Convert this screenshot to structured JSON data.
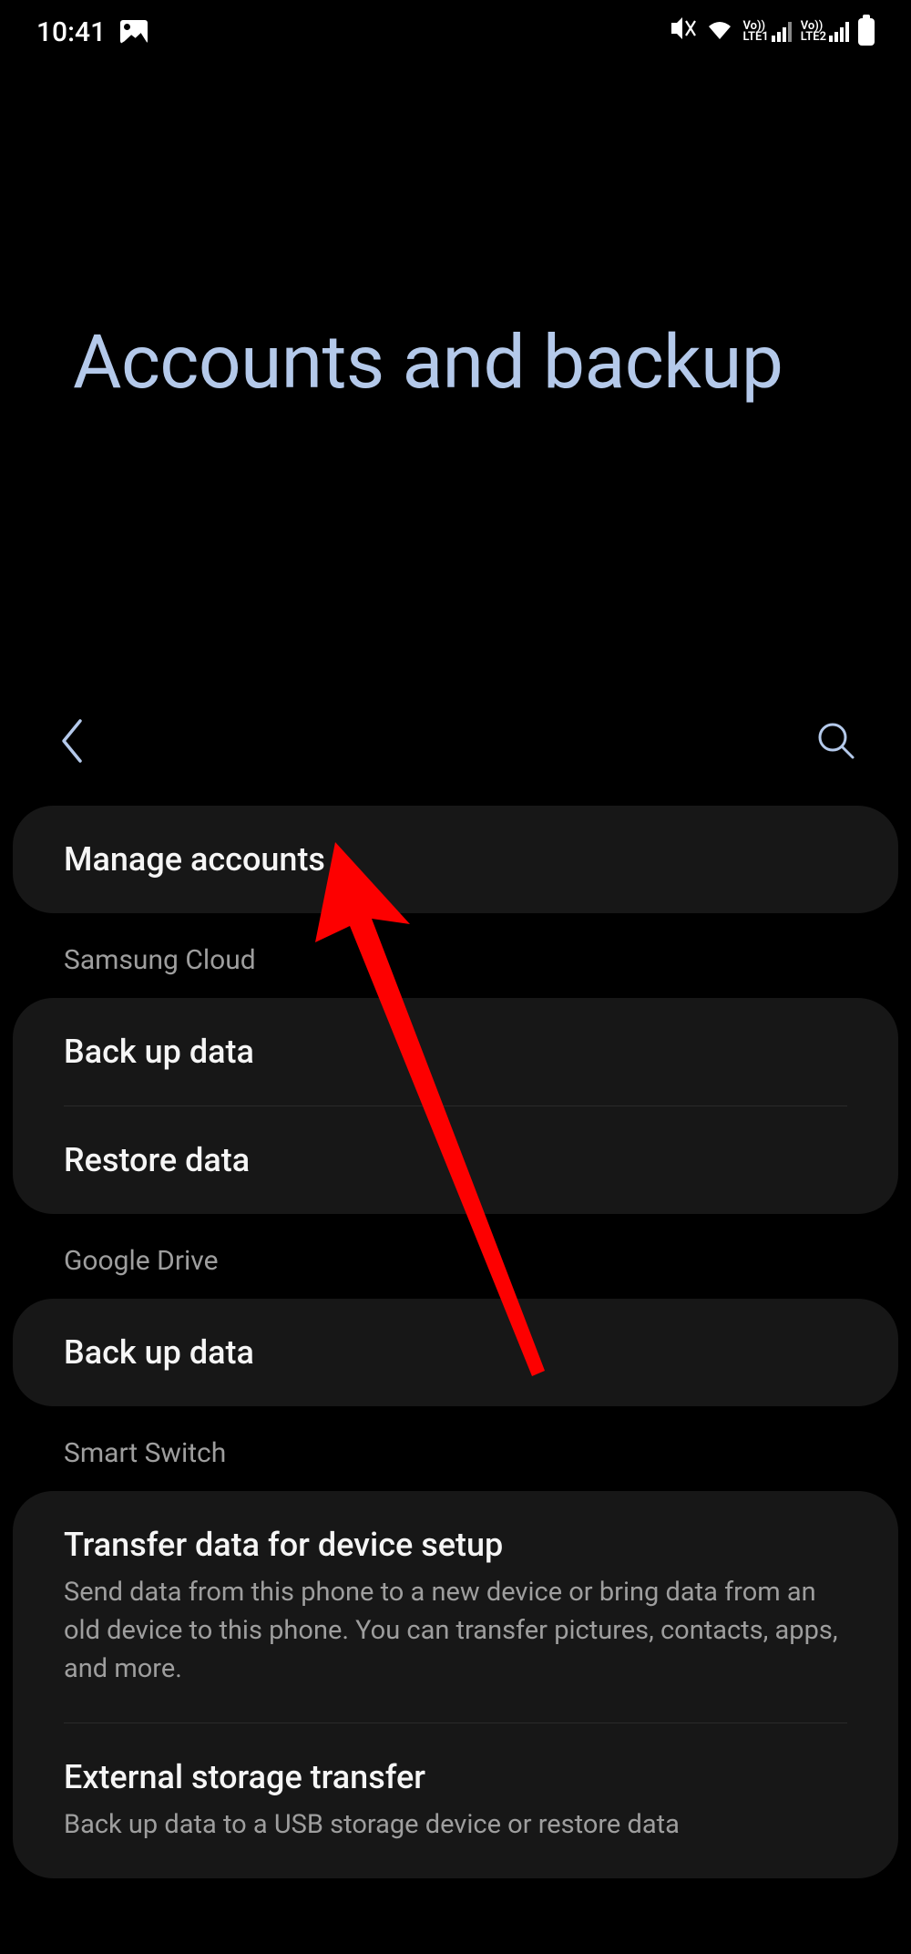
{
  "status_bar": {
    "time": "10:41",
    "sim1_label": "Vo))\nLTE1",
    "sim2_label": "Vo))\nLTE2"
  },
  "page": {
    "title": "Accounts and backup"
  },
  "sections": {
    "manage": {
      "items": [
        {
          "title": "Manage accounts"
        }
      ]
    },
    "samsung_cloud": {
      "header": "Samsung Cloud",
      "items": [
        {
          "title": "Back up data"
        },
        {
          "title": "Restore data"
        }
      ]
    },
    "google_drive": {
      "header": "Google Drive",
      "items": [
        {
          "title": "Back up data"
        }
      ]
    },
    "smart_switch": {
      "header": "Smart Switch",
      "items": [
        {
          "title": "Transfer data for device setup",
          "subtitle": "Send data from this phone to a new device or bring data from an old device to this phone. You can transfer pictures, contacts, apps, and more."
        },
        {
          "title": "External storage transfer",
          "subtitle": "Back up data to a USB storage device or restore data"
        }
      ]
    }
  }
}
